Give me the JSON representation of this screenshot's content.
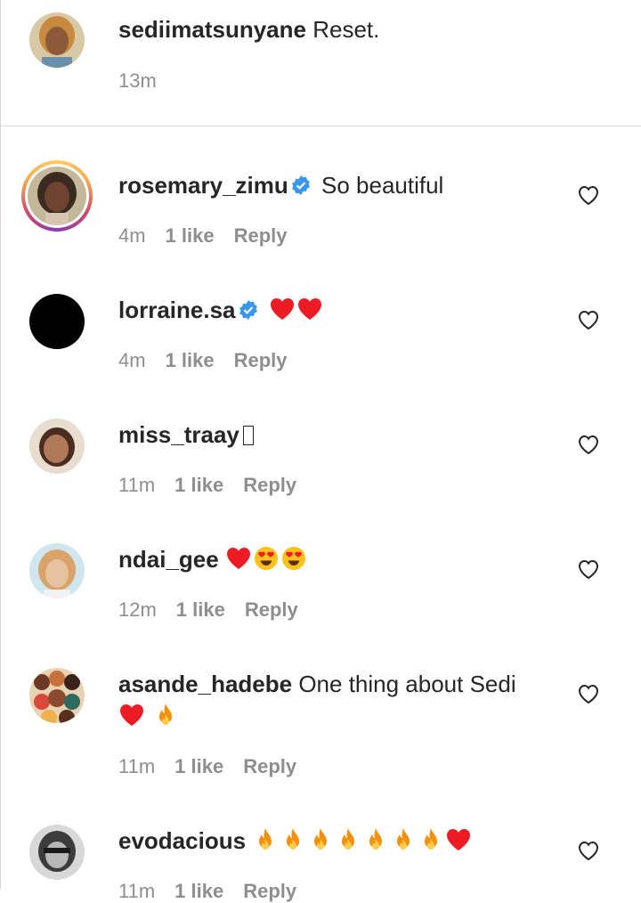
{
  "caption": {
    "username": "sediimatsunyane",
    "text": "Reset.",
    "time": "13m"
  },
  "comments": [
    {
      "username": "rosemary_zimu",
      "verified": true,
      "text": "So beautiful",
      "emojis": [],
      "time": "4m",
      "likes": "1 like",
      "reply": "Reply"
    },
    {
      "username": "lorraine.sa",
      "verified": true,
      "text": "",
      "emojis": [
        "red-heart",
        "red-heart"
      ],
      "time": "4m",
      "likes": "1 like",
      "reply": "Reply"
    },
    {
      "username": "miss_traay",
      "verified": false,
      "text": "",
      "emojis": [
        "missing-glyph"
      ],
      "time": "11m",
      "likes": "1 like",
      "reply": "Reply"
    },
    {
      "username": "ndai_gee",
      "verified": false,
      "text": "",
      "emojis": [
        "red-heart",
        "heart-eyes",
        "heart-eyes"
      ],
      "time": "12m",
      "likes": "1 like",
      "reply": "Reply"
    },
    {
      "username": "asande_hadebe",
      "verified": false,
      "text": "One thing about Sedi",
      "emojis": [
        "red-heart",
        "fire"
      ],
      "time": "11m",
      "likes": "1 like",
      "reply": "Reply"
    },
    {
      "username": "evodacious",
      "verified": false,
      "text": "",
      "emojis": [
        "fire",
        "fire",
        "fire",
        "fire",
        "fire",
        "fire",
        "fire",
        "red-heart"
      ],
      "time": "11m",
      "likes": "1 like",
      "reply": "Reply"
    }
  ],
  "colors": {
    "text": "#262626",
    "secondary": "#8e8e8e",
    "verified": "#3897f0",
    "heart": "#ed1c24"
  }
}
